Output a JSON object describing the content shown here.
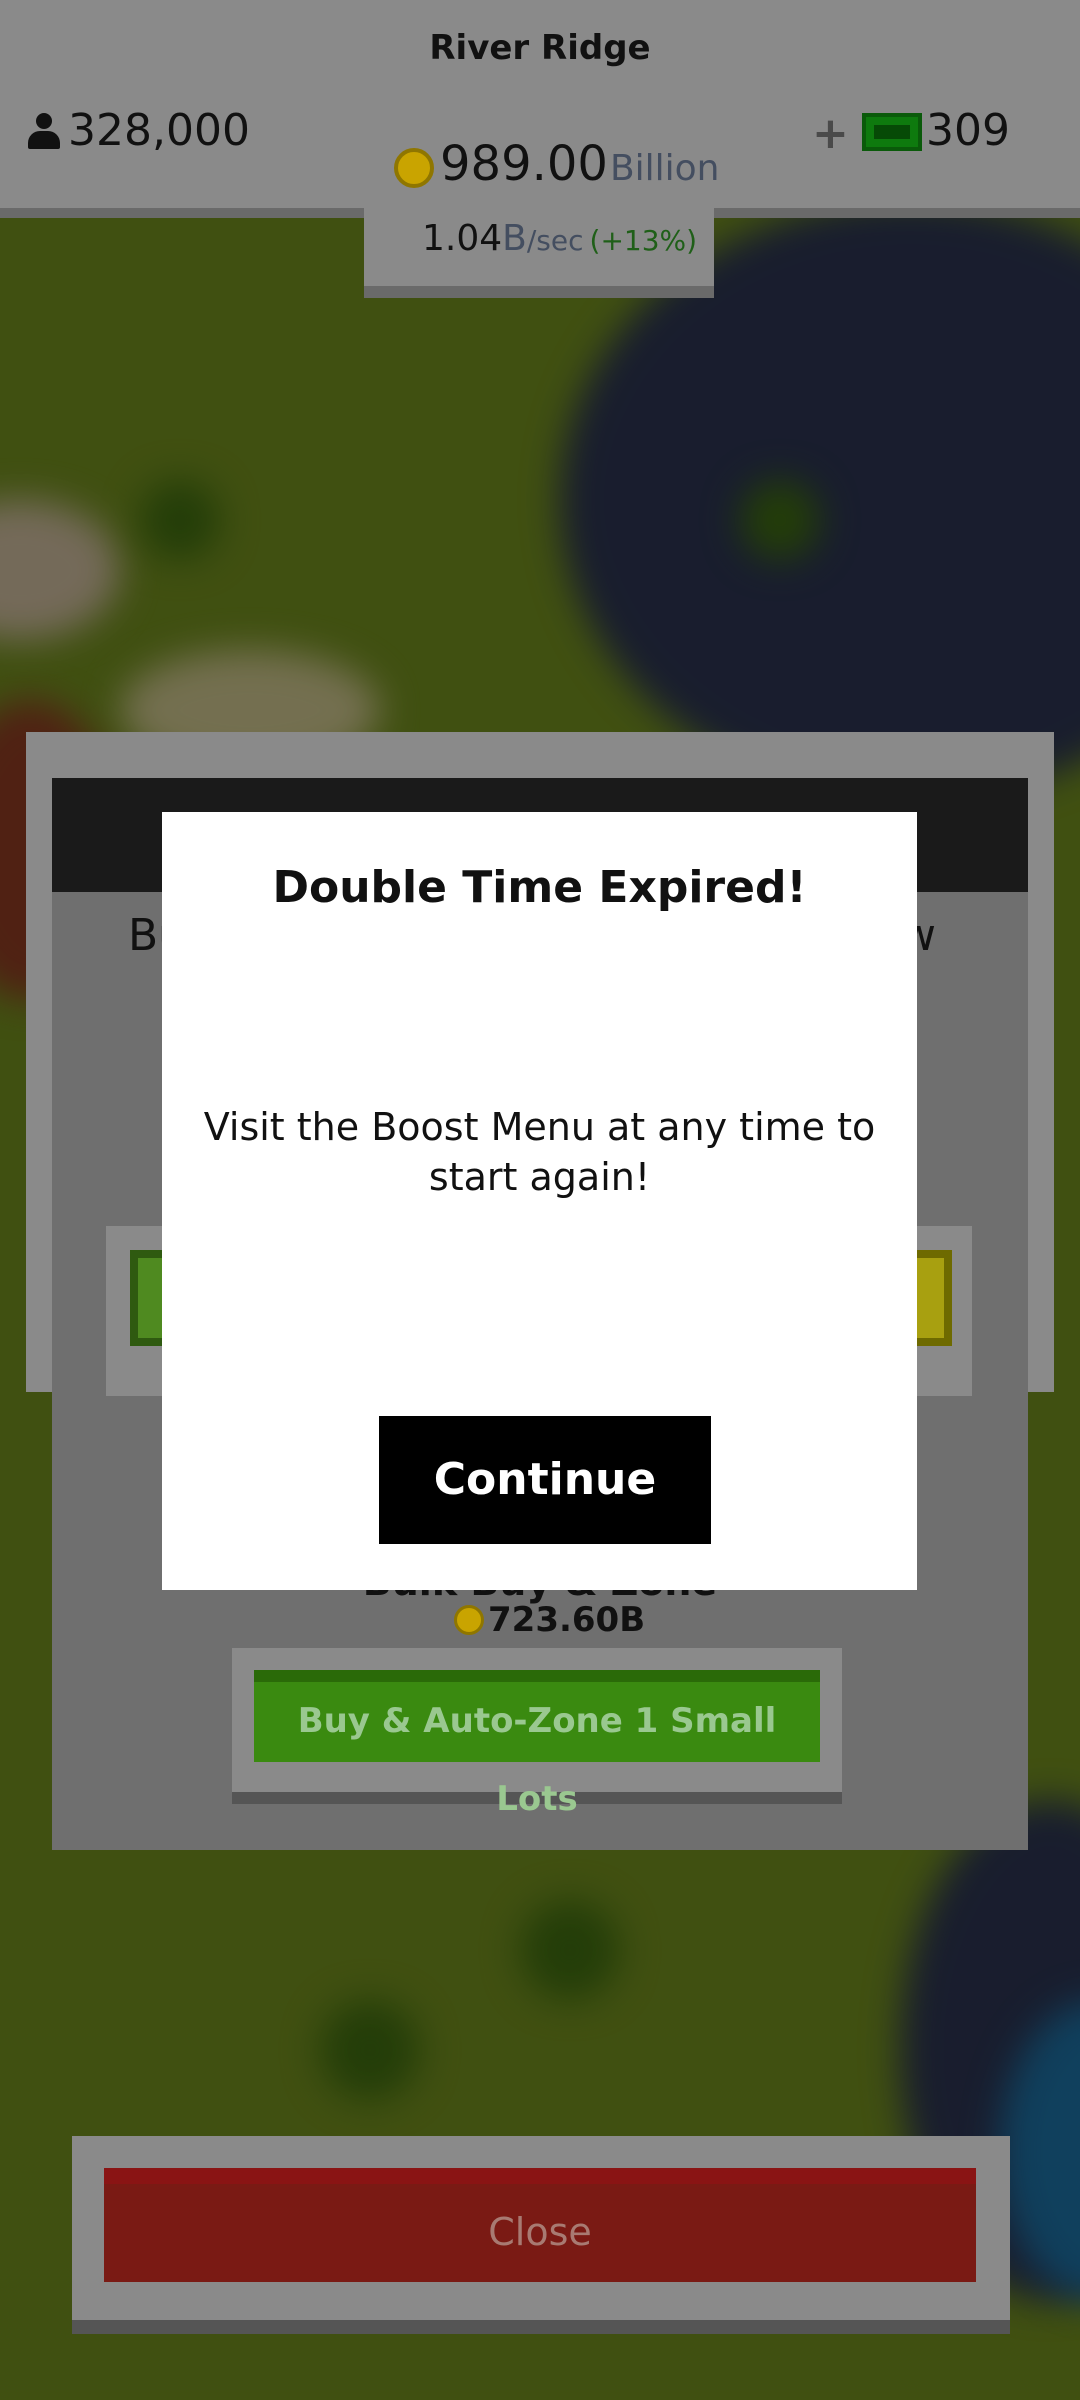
{
  "hud": {
    "city_name": "River Ridge",
    "population": "328,000",
    "coins_amount": "989.00",
    "coins_unit": "Billion",
    "rate_value": "1.04",
    "rate_unit": "B",
    "rate_per": "/sec",
    "rate_bonus": "(+13%)",
    "plus_symbol": "+",
    "cash_count": "309"
  },
  "panel": {
    "text_left_fragment": "Bu",
    "text_right_fragment": "w",
    "bulk_label": "Bulk Buy & Zone",
    "bulk_price": "723.60B",
    "buy_button_label": "Buy & Auto-Zone 1 Small Lots"
  },
  "close_button_label": "Close",
  "modal": {
    "title": "Double Time Expired!",
    "message": "Visit the Boost Menu at any time to start again!",
    "continue_label": "Continue"
  },
  "colors": {
    "hud_gray": "#8a8a8a",
    "grass": "#6f8a1e",
    "water": "#2b3350",
    "buy_green": "#3a8a10",
    "close_red": "#7a1a14",
    "modal_white": "#ffffff"
  },
  "icons": {
    "population": "person-icon",
    "coins": "coin-icon",
    "cash": "cash-icon"
  }
}
